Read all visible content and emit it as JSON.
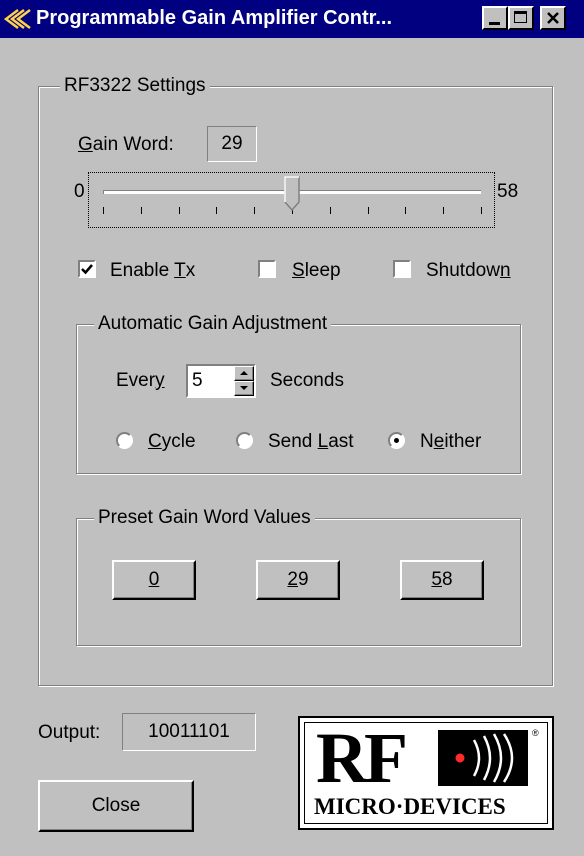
{
  "window": {
    "title": "Programmable Gain Amplifier Contr...",
    "controls": [
      "minimize",
      "maximize",
      "close"
    ]
  },
  "settings_group": {
    "legend": "RF3322 Settings",
    "gain_word_label_accel": "G",
    "gain_word_label_rest": "ain Word:",
    "gain_word_value": "29",
    "slider": {
      "min_label": "0",
      "max_label": "58",
      "min": 0,
      "max": 58,
      "value": 29
    },
    "enable_tx": {
      "label_pre": "Enable ",
      "label_accel": "T",
      "label_post": "x",
      "checked": true
    },
    "sleep": {
      "label_accel": "S",
      "label_post": "leep",
      "checked": false
    },
    "shutdown": {
      "label_pre": "Shutdow",
      "label_accel": "n",
      "checked": false
    }
  },
  "auto_gain_group": {
    "legend": "Automatic Gain Adjustment",
    "every_pre": "Ever",
    "every_accel": "y",
    "interval_value": "5",
    "seconds_label": "Seconds",
    "options": [
      {
        "accel": "C",
        "rest": "ycle",
        "selected": false
      },
      {
        "pre": "Send ",
        "accel": "L",
        "rest": "ast",
        "selected": false
      },
      {
        "pre": "N",
        "accel": "e",
        "rest": "ither",
        "selected": true
      }
    ]
  },
  "preset_group": {
    "legend": "Preset Gain Word Values",
    "buttons": [
      {
        "accel": "0",
        "rest": ""
      },
      {
        "accel": "2",
        "rest": "9"
      },
      {
        "accel": "5",
        "rest": "8"
      }
    ]
  },
  "output": {
    "label": "Output:",
    "value": "10011101"
  },
  "close_button_label": "Close",
  "logo": {
    "top_text": "RF",
    "bottom_text": "MICRO·DEVICES",
    "registered": "®"
  }
}
